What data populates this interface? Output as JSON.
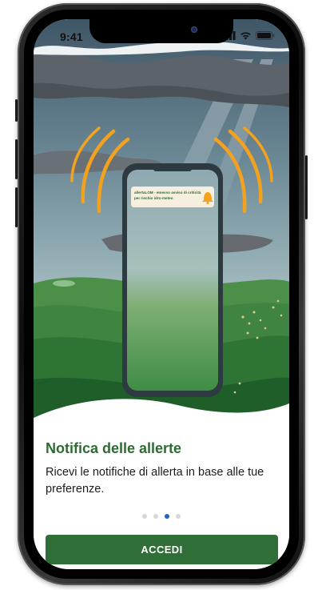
{
  "status_bar": {
    "time": "9:41",
    "icons": [
      "signal-icon",
      "wifi-icon",
      "battery-icon"
    ]
  },
  "illustration": {
    "notification_text": "allertaLOM - emesso avviso di criticità per rischio idro-meteo",
    "notification_icon": "bell-icon"
  },
  "onboarding": {
    "title": "Notifica delle allerte",
    "description": "Ricevi le notifiche di allerta in base alle tue preferenze.",
    "page_count": 4,
    "active_page": 3,
    "cta_label": "ACCEDI"
  },
  "colors": {
    "primary_green": "#2f6e36",
    "title_green": "#2e6b32",
    "active_dot": "#1f66c4",
    "inactive_dot": "#d7d7d7",
    "alert_orange": "#f4a21d"
  }
}
